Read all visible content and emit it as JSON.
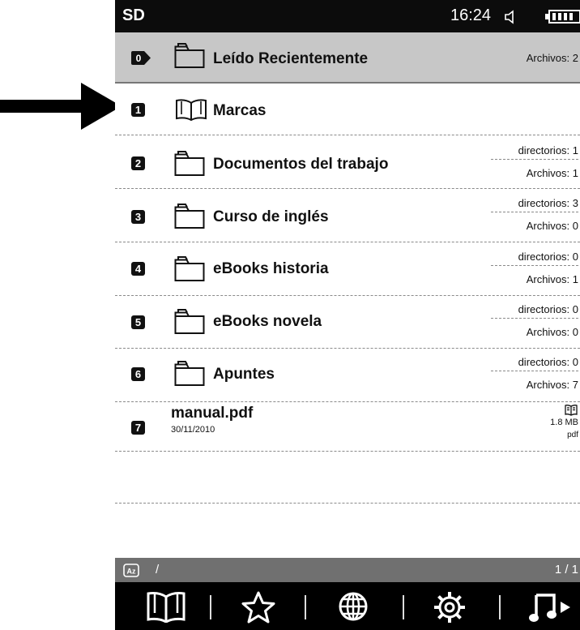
{
  "statusbar": {
    "storage": "SD",
    "time": "16:24",
    "icons": [
      "speaker-icon",
      "battery-icon"
    ]
  },
  "recent": {
    "index": "0",
    "label": "Leído Recientemente",
    "files": "Archivos: 2"
  },
  "items": [
    {
      "index": "1",
      "label": "Marcas",
      "icon": "bookmark-book-icon"
    },
    {
      "index": "2",
      "label": "Documentos del trabajo",
      "dirs": "directorios: 1",
      "files": "Archivos: 1",
      "icon": "folder-icon"
    },
    {
      "index": "3",
      "label": "Curso de inglés",
      "dirs": "directorios: 3",
      "files": "Archivos: 0",
      "icon": "folder-icon"
    },
    {
      "index": "4",
      "label": "eBooks historia",
      "dirs": "directorios: 0",
      "files": "Archivos: 1",
      "icon": "folder-icon"
    },
    {
      "index": "5",
      "label": "eBooks novela",
      "dirs": "directorios: 0",
      "files": "Archivos: 0",
      "icon": "folder-icon"
    },
    {
      "index": "6",
      "label": "Apuntes",
      "dirs": "directorios: 0",
      "files": "Archivos: 7",
      "icon": "folder-icon"
    }
  ],
  "file": {
    "index": "7",
    "name": "manual.pdf",
    "date": "30/11/2010",
    "size": "1.8 MB",
    "type": "pdf",
    "icon": "open-book-icon"
  },
  "pathbar": {
    "path": "/",
    "page": "1 / 1",
    "sort_icon": "sort-az-icon"
  },
  "toolbar": {
    "icons": [
      "library-icon",
      "favorites-star-icon",
      "browser-globe-icon",
      "settings-gear-icon",
      "music-icon"
    ]
  },
  "annotation": {
    "arrow_color": "#000000"
  }
}
